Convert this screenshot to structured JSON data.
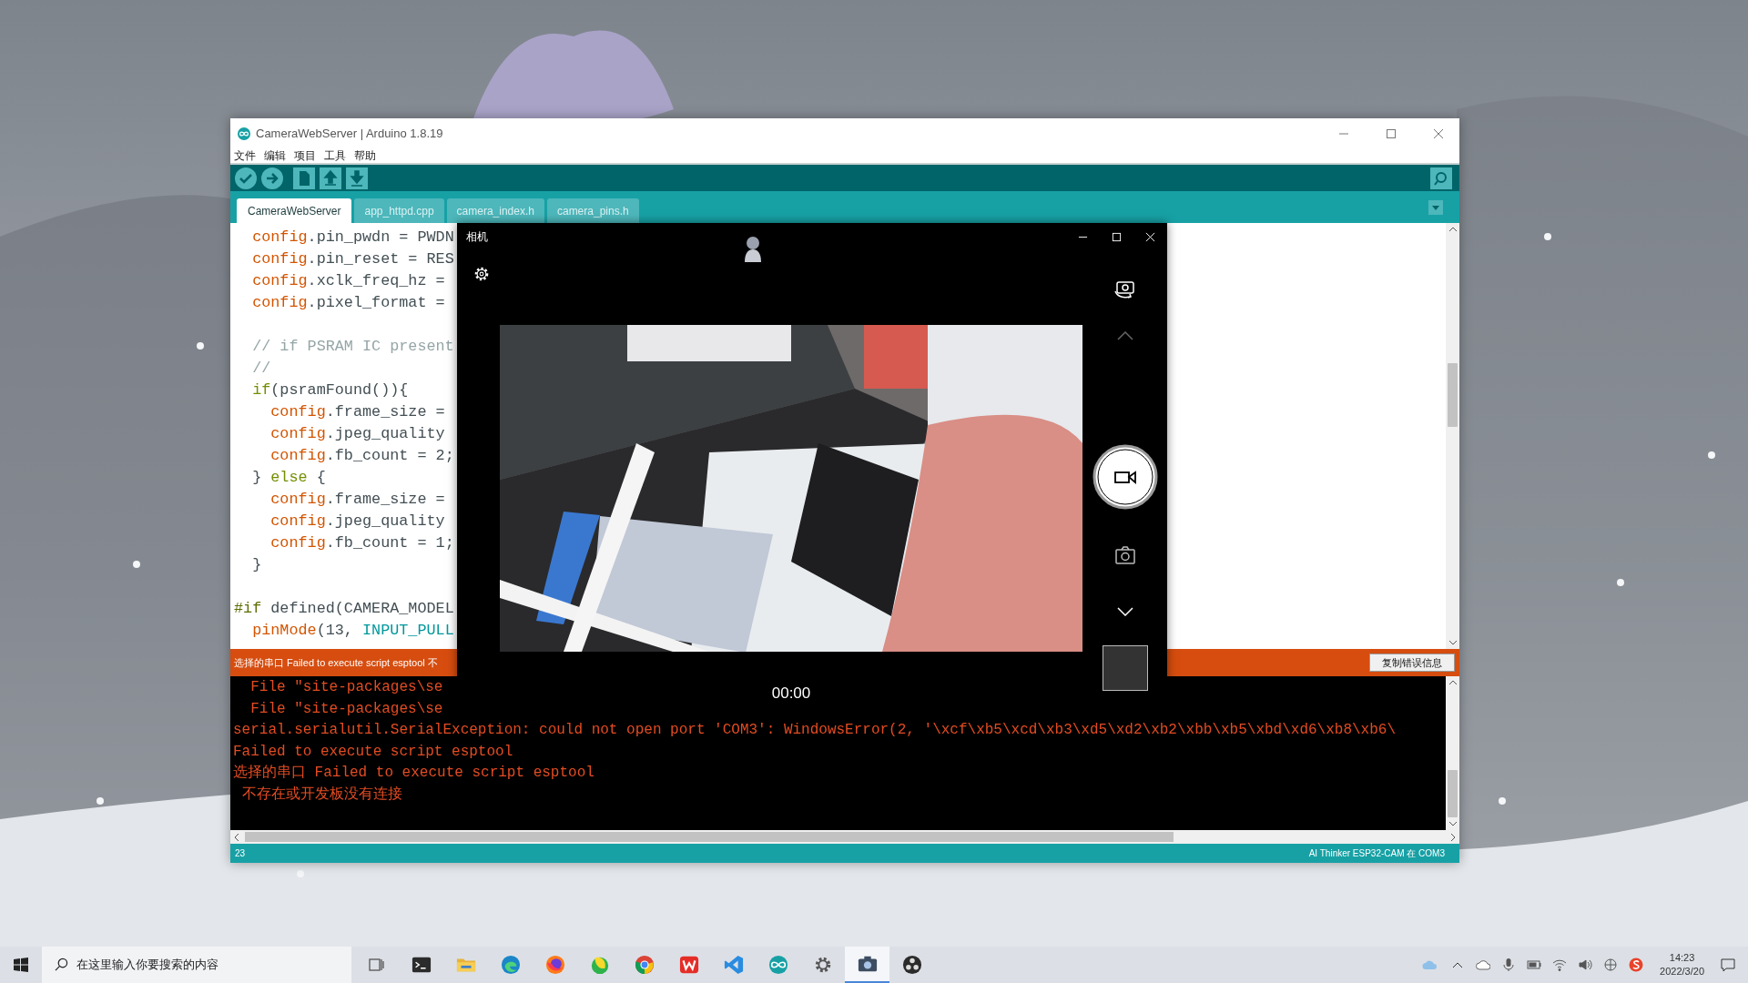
{
  "arduino": {
    "title": "CameraWebServer | Arduino 1.8.19",
    "menu": [
      "文件",
      "编辑",
      "项目",
      "工具",
      "帮助"
    ],
    "tabs": [
      {
        "label": "CameraWebServer",
        "selected": true
      },
      {
        "label": "app_httpd.cpp",
        "selected": false
      },
      {
        "label": "camera_index.h",
        "selected": false
      },
      {
        "label": "camera_pins.h",
        "selected": false
      }
    ],
    "code_lines": [
      {
        "blank_before": false,
        "tokens": [
          {
            "text": "  config",
            "kind": "function"
          },
          {
            "text": ".pin_pwdn = PWDN",
            "kind": "plain"
          }
        ]
      },
      {
        "blank_before": false,
        "tokens": [
          {
            "text": "  config",
            "kind": "function"
          },
          {
            "text": ".pin_reset = RES",
            "kind": "plain"
          }
        ]
      },
      {
        "blank_before": false,
        "tokens": [
          {
            "text": "  config",
            "kind": "function"
          },
          {
            "text": ".xclk_freq_hz =",
            "kind": "plain"
          }
        ]
      },
      {
        "blank_before": false,
        "tokens": [
          {
            "text": "  config",
            "kind": "function"
          },
          {
            "text": ".pixel_format =",
            "kind": "plain"
          }
        ]
      },
      {
        "blank_before": true,
        "tokens": [
          {
            "text": "  // if PSRAM IC present",
            "kind": "comment"
          }
        ]
      },
      {
        "blank_before": false,
        "tokens": [
          {
            "text": "  //",
            "kind": "comment"
          }
        ]
      },
      {
        "blank_before": false,
        "tokens": [
          {
            "text": "  if",
            "kind": "keyword"
          },
          {
            "text": "(psramFound()){",
            "kind": "plain"
          }
        ]
      },
      {
        "blank_before": false,
        "tokens": [
          {
            "text": "    config",
            "kind": "function"
          },
          {
            "text": ".frame_size =",
            "kind": "plain"
          }
        ]
      },
      {
        "blank_before": false,
        "tokens": [
          {
            "text": "    config",
            "kind": "function"
          },
          {
            "text": ".jpeg_quality",
            "kind": "plain"
          }
        ]
      },
      {
        "blank_before": false,
        "tokens": [
          {
            "text": "    config",
            "kind": "function"
          },
          {
            "text": ".fb_count = 2;",
            "kind": "plain"
          }
        ]
      },
      {
        "blank_before": false,
        "tokens": [
          {
            "text": "  } ",
            "kind": "plain"
          },
          {
            "text": "else",
            "kind": "keyword"
          },
          {
            "text": " {",
            "kind": "plain"
          }
        ]
      },
      {
        "blank_before": false,
        "tokens": [
          {
            "text": "    config",
            "kind": "function"
          },
          {
            "text": ".frame_size =",
            "kind": "plain"
          }
        ]
      },
      {
        "blank_before": false,
        "tokens": [
          {
            "text": "    config",
            "kind": "function"
          },
          {
            "text": ".jpeg_quality",
            "kind": "plain"
          }
        ]
      },
      {
        "blank_before": false,
        "tokens": [
          {
            "text": "    config",
            "kind": "function"
          },
          {
            "text": ".fb_count = 1;",
            "kind": "plain"
          }
        ]
      },
      {
        "blank_before": false,
        "tokens": [
          {
            "text": "  }",
            "kind": "plain"
          }
        ]
      },
      {
        "blank_before": true,
        "tokens": [
          {
            "text": "#if",
            "kind": "directive"
          },
          {
            "text": " defined(CAMERA_MODEL",
            "kind": "plain"
          }
        ]
      },
      {
        "blank_before": false,
        "tokens": [
          {
            "text": "  pinMode",
            "kind": "function"
          },
          {
            "text": "(13, ",
            "kind": "plain"
          },
          {
            "text": "INPUT_PULL",
            "kind": "constant"
          }
        ]
      }
    ],
    "error_bar": {
      "message": "选择的串口 Failed to execute script esptool 不",
      "button": "复制错误信息"
    },
    "console_lines": [
      "  File \"site-packages\\se",
      "  File \"site-packages\\se",
      "serial.serialutil.SerialException: could not open port 'COM3': WindowsError(2, '\\xcf\\xb5\\xcd\\xb3\\xd5\\xd2\\xb2\\xbb\\xb5\\xbd\\xd6\\xb8\\xb6\\",
      "Failed to execute script esptool",
      "选择的串口 Failed to execute script esptool",
      " 不存在或开发板没有连接"
    ],
    "status_bar": {
      "line": "23",
      "board": "AI Thinker ESP32-CAM 在 COM3"
    }
  },
  "camera": {
    "title": "相机",
    "timer": "00:00"
  },
  "taskbar": {
    "search": {
      "placeholder": "在这里输入你要搜索的内容"
    },
    "apps": [
      {
        "kind": "terminal",
        "selected": false
      },
      {
        "kind": "folder",
        "selected": false
      },
      {
        "kind": "swirl",
        "selected": false
      },
      {
        "kind": "fox",
        "selected": false
      },
      {
        "kind": "leaf",
        "selected": false
      },
      {
        "kind": "wheel",
        "selected": false
      },
      {
        "kind": "tile",
        "selected": false
      },
      {
        "kind": "ribbon",
        "selected": false
      },
      {
        "kind": "infinity",
        "selected": false
      },
      {
        "kind": "gear",
        "selected": false
      },
      {
        "kind": "camera",
        "selected": true
      },
      {
        "kind": "aperture",
        "selected": false
      }
    ],
    "time": "14:23",
    "date": "2022/3/20"
  }
}
